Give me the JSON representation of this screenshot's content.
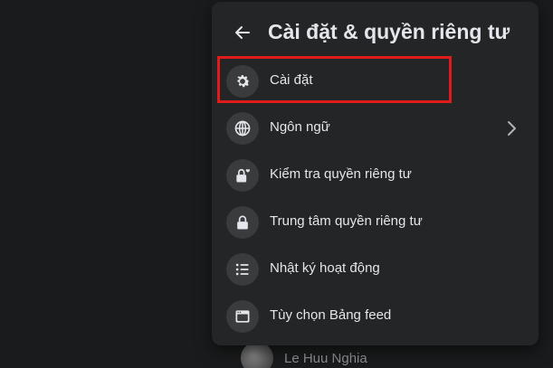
{
  "panel": {
    "title": "Cài đặt & quyền riêng tư",
    "back_icon": "arrow-left-icon"
  },
  "menu": {
    "items": [
      {
        "label": "Cài đặt",
        "icon": "gear-icon",
        "highlighted": true
      },
      {
        "label": "Ngôn ngữ",
        "icon": "globe-icon",
        "has_submenu": true
      },
      {
        "label": "Kiểm tra quyền riêng tư",
        "icon": "lock-heart-icon"
      },
      {
        "label": "Trung tâm quyền riêng tư",
        "icon": "lock-icon"
      },
      {
        "label": "Nhật ký hoạt động",
        "icon": "list-icon"
      },
      {
        "label": "Tùy chọn Bảng feed",
        "icon": "feed-icon"
      }
    ]
  },
  "behind": {
    "user_name": "Le Huu Nghia"
  },
  "colors": {
    "background": "#18191a",
    "panel": "#242526",
    "icon_circle": "#3a3b3c",
    "text": "#e4e6eb",
    "highlight": "#e01b1b"
  }
}
